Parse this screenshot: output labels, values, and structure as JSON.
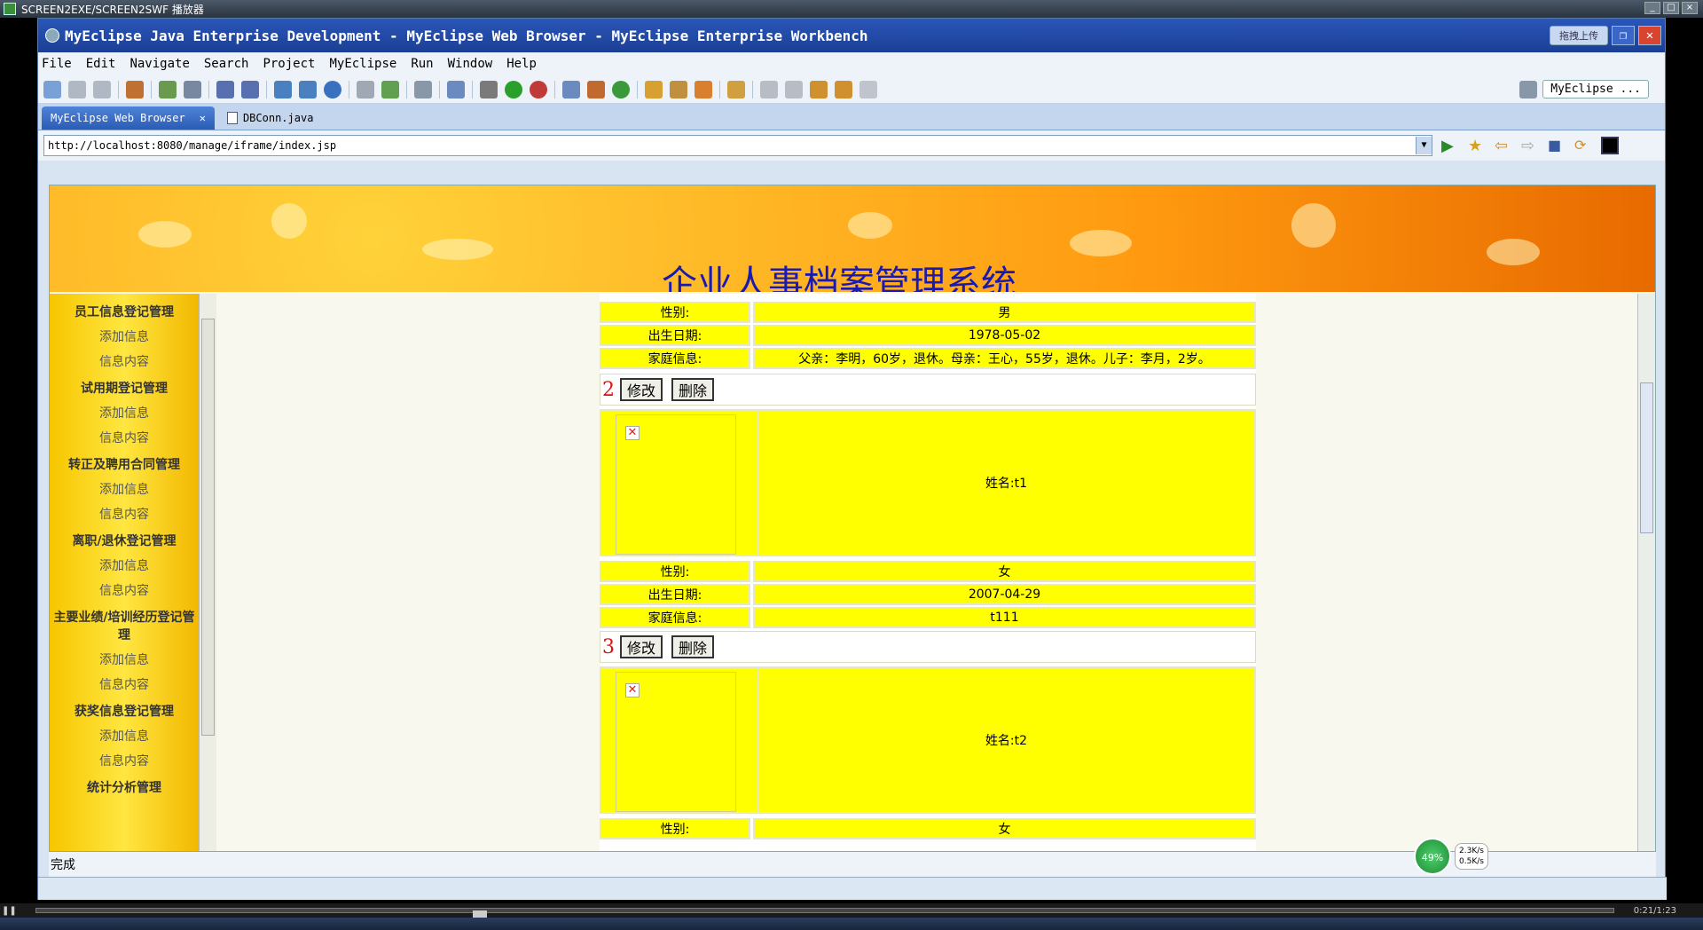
{
  "player": {
    "title": "SCREEN2EXE/SCREEN2SWF 播放器",
    "time": "0:21/1:23"
  },
  "window": {
    "title": "MyEclipse Java Enterprise Development - MyEclipse Web Browser - MyEclipse Enterprise Workbench",
    "upload_label": "拖拽上传"
  },
  "menu": [
    "File",
    "Edit",
    "Navigate",
    "Search",
    "Project",
    "MyEclipse",
    "Run",
    "Window",
    "Help"
  ],
  "perspective": {
    "label": "MyEclipse ..."
  },
  "tabs": [
    {
      "label": "MyEclipse Web Browser",
      "active": true
    },
    {
      "label": "DBConn.java",
      "active": false
    }
  ],
  "browser": {
    "url": "http://localhost:8080/manage/iframe/index.jsp"
  },
  "page": {
    "banner_title": "企业人事档案管理系统",
    "sidebar": [
      {
        "head": "员工信息登记管理",
        "items": [
          "添加信息",
          "信息内容"
        ]
      },
      {
        "head": "试用期登记管理",
        "items": [
          "添加信息",
          "信息内容"
        ]
      },
      {
        "head": "转正及聘用合同管理",
        "items": [
          "添加信息",
          "信息内容"
        ]
      },
      {
        "head": "离职/退休登记管理",
        "items": [
          "添加信息",
          "信息内容"
        ]
      },
      {
        "head": "主要业绩/培训经历登记管理",
        "items": [
          "添加信息",
          "信息内容"
        ]
      },
      {
        "head": "获奖信息登记管理",
        "items": [
          "添加信息",
          "信息内容"
        ]
      },
      {
        "head": "统计分析管理",
        "items": []
      }
    ],
    "labels": {
      "gender": "性别:",
      "birth": "出生日期:",
      "family": "家庭信息:",
      "edit": "修改",
      "delete": "删除"
    },
    "records": [
      {
        "gender": "男",
        "birth": "1978-05-02",
        "family": "父亲：李明，60岁，退休。母亲：王心，55岁，退休。儿子：李月，2岁。"
      },
      {
        "num": "2",
        "name": "姓名:t1",
        "gender": "女",
        "birth": "2007-04-29",
        "family": "t111"
      },
      {
        "num": "3",
        "name": "姓名:t2",
        "gender": "女"
      }
    ]
  },
  "status": {
    "text": "完成",
    "net_percent": "49%",
    "up": "2.3K/s",
    "down": "0.5K/s"
  }
}
